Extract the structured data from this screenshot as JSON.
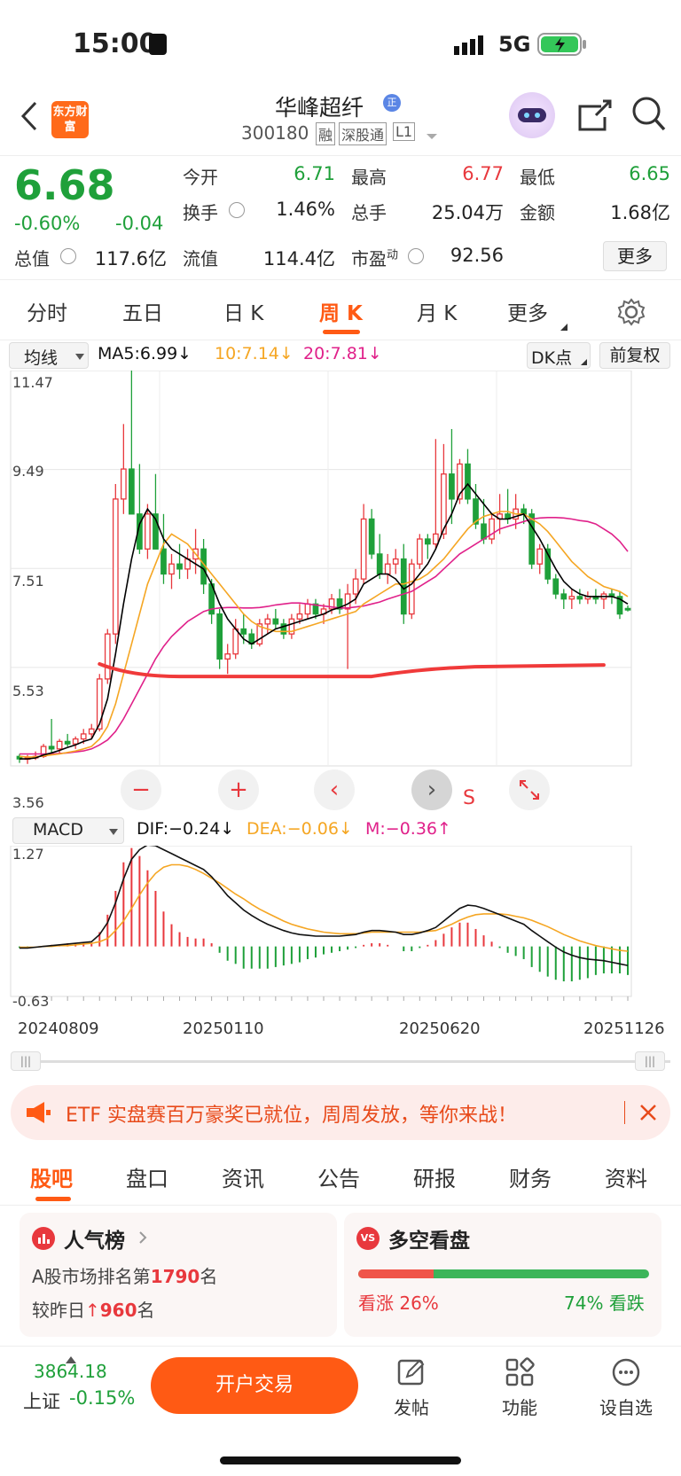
{
  "status_bar": {
    "time": "15:00",
    "network": "5G"
  },
  "header": {
    "logo": "东方财富",
    "stock_name": "华峰超纤",
    "stock_code": "300180",
    "tags": [
      "融",
      "深股通",
      "L1"
    ]
  },
  "quote": {
    "price": "6.68",
    "change_pct": "-0.60%",
    "change": "-0.04",
    "open_label": "今开",
    "open": "6.71",
    "high_label": "最高",
    "high": "6.77",
    "low_label": "最低",
    "low": "6.65",
    "turnover_label": "换手",
    "turnover": "1.46%",
    "volume_label": "总手",
    "volume": "25.04万",
    "amount_label": "金额",
    "amount": "1.68亿",
    "mktcap_label": "总值",
    "mktcap": "117.6亿",
    "float_label": "流值",
    "float": "114.4亿",
    "pe_label": "市盈",
    "pe_sup": "动",
    "pe": "92.56",
    "more_button": "更多"
  },
  "period_tabs": [
    "分时",
    "五日",
    "日 K",
    "周 K",
    "月 K",
    "更多"
  ],
  "active_period": "周 K",
  "ma_bar": {
    "selector": "均线",
    "ma5": "MA5:6.99↓",
    "ma10": "10:7.14↓",
    "ma20": "20:7.81↓",
    "dk_button": "DK点",
    "adjust_button": "前复权"
  },
  "chart_data": [
    {
      "type": "candlestick",
      "title": "",
      "y_ticks": [
        "11.47",
        "9.49",
        "7.51",
        "5.53",
        "3.56"
      ],
      "ylim": [
        3.56,
        11.47
      ],
      "series": [
        {
          "name": "MA5",
          "color": "#000000"
        },
        {
          "name": "10",
          "color": "#f5a623"
        },
        {
          "name": "20",
          "color": "#e0218a"
        }
      ],
      "candles_ohlc": [
        [
          3.75,
          3.8,
          3.62,
          3.7
        ],
        [
          3.7,
          3.78,
          3.6,
          3.72
        ],
        [
          3.72,
          3.85,
          3.68,
          3.75
        ],
        [
          3.75,
          4.0,
          3.72,
          3.95
        ],
        [
          3.95,
          4.5,
          3.8,
          3.9
        ],
        [
          3.9,
          4.1,
          3.8,
          4.05
        ],
        [
          4.05,
          4.2,
          3.95,
          4.0
        ],
        [
          4.0,
          4.15,
          3.9,
          4.1
        ],
        [
          4.1,
          4.3,
          4.0,
          4.2
        ],
        [
          4.2,
          4.4,
          4.1,
          4.3
        ],
        [
          4.3,
          5.4,
          4.25,
          5.3
        ],
        [
          5.3,
          6.3,
          5.2,
          6.2
        ],
        [
          6.2,
          9.2,
          6.0,
          8.9
        ],
        [
          8.9,
          10.4,
          8.6,
          9.5
        ],
        [
          9.5,
          11.47,
          8.8,
          8.6
        ],
        [
          8.6,
          9.6,
          7.8,
          7.9
        ],
        [
          7.9,
          8.8,
          7.7,
          8.6
        ],
        [
          8.6,
          9.4,
          7.9,
          7.9
        ],
        [
          7.9,
          8.6,
          7.2,
          7.4
        ],
        [
          7.4,
          7.8,
          7.1,
          7.6
        ],
        [
          7.6,
          8.0,
          7.3,
          7.5
        ],
        [
          7.5,
          7.9,
          7.3,
          7.7
        ],
        [
          7.7,
          8.3,
          7.4,
          7.9
        ],
        [
          7.9,
          8.1,
          7.0,
          7.2
        ],
        [
          7.2,
          7.3,
          6.4,
          6.6
        ],
        [
          6.6,
          6.7,
          5.5,
          5.7
        ],
        [
          5.7,
          6.0,
          5.4,
          5.8
        ],
        [
          5.8,
          6.5,
          5.7,
          6.3
        ],
        [
          6.3,
          6.6,
          6.0,
          6.2
        ],
        [
          6.2,
          6.3,
          5.9,
          6.0
        ],
        [
          6.0,
          6.5,
          5.95,
          6.4
        ],
        [
          6.4,
          6.6,
          6.2,
          6.5
        ],
        [
          6.5,
          6.7,
          6.3,
          6.4
        ],
        [
          6.4,
          6.5,
          6.1,
          6.2
        ],
        [
          6.2,
          6.6,
          6.1,
          6.5
        ],
        [
          6.5,
          6.8,
          6.4,
          6.6
        ],
        [
          6.6,
          6.9,
          6.5,
          6.8
        ],
        [
          6.8,
          6.9,
          6.5,
          6.6
        ],
        [
          6.6,
          6.8,
          6.4,
          6.7
        ],
        [
          6.7,
          7.0,
          6.6,
          6.9
        ],
        [
          6.9,
          7.1,
          6.6,
          6.7
        ],
        [
          6.7,
          7.2,
          5.5,
          7.0
        ],
        [
          7.0,
          7.5,
          6.8,
          7.3
        ],
        [
          7.3,
          8.8,
          7.2,
          8.5
        ],
        [
          8.5,
          8.7,
          7.7,
          7.8
        ],
        [
          7.8,
          8.2,
          7.3,
          7.4
        ],
        [
          7.4,
          7.8,
          7.2,
          7.6
        ],
        [
          7.6,
          7.9,
          7.4,
          7.7
        ],
        [
          7.7,
          8.0,
          6.4,
          6.6
        ],
        [
          6.6,
          7.7,
          6.5,
          7.6
        ],
        [
          7.6,
          8.2,
          7.5,
          8.1
        ],
        [
          8.1,
          8.2,
          7.7,
          8.0
        ],
        [
          8.0,
          10.1,
          7.9,
          8.2
        ],
        [
          8.2,
          10.0,
          8.1,
          9.4
        ],
        [
          9.4,
          10.3,
          8.4,
          8.9
        ],
        [
          8.9,
          9.7,
          8.8,
          9.6
        ],
        [
          9.6,
          9.9,
          8.8,
          8.9
        ],
        [
          8.9,
          9.2,
          8.3,
          8.4
        ],
        [
          8.4,
          8.9,
          8.0,
          8.1
        ],
        [
          8.1,
          8.6,
          8.0,
          8.5
        ],
        [
          8.5,
          9.0,
          8.2,
          8.6
        ],
        [
          8.6,
          9.1,
          8.4,
          8.5
        ],
        [
          8.5,
          9.0,
          8.3,
          8.7
        ],
        [
          8.7,
          8.8,
          8.4,
          8.6
        ],
        [
          8.6,
          8.7,
          7.5,
          7.6
        ],
        [
          7.6,
          8.0,
          7.4,
          7.9
        ],
        [
          7.9,
          8.0,
          7.2,
          7.3
        ],
        [
          7.3,
          7.4,
          6.9,
          7.0
        ],
        [
          7.0,
          7.1,
          6.7,
          6.9
        ],
        [
          6.9,
          7.1,
          6.7,
          6.95
        ],
        [
          6.95,
          7.1,
          6.8,
          6.9
        ],
        [
          6.9,
          7.05,
          6.8,
          6.95
        ],
        [
          6.95,
          7.1,
          6.8,
          6.9
        ],
        [
          6.9,
          7.05,
          6.7,
          7.0
        ],
        [
          7.0,
          7.1,
          6.8,
          6.95
        ],
        [
          6.95,
          7.05,
          6.5,
          6.6
        ],
        [
          6.71,
          6.77,
          6.65,
          6.68
        ]
      ],
      "ma5": [
        3.7,
        3.7,
        3.72,
        3.78,
        3.82,
        3.87,
        3.93,
        3.98,
        4.05,
        4.1,
        4.4,
        4.9,
        5.8,
        6.8,
        7.7,
        8.4,
        8.7,
        8.5,
        8.1,
        7.9,
        7.8,
        7.7,
        7.6,
        7.5,
        7.2,
        6.8,
        6.5,
        6.3,
        6.1,
        6.0,
        6.1,
        6.2,
        6.3,
        6.35,
        6.4,
        6.45,
        6.5,
        6.55,
        6.6,
        6.68,
        6.73,
        6.8,
        6.9,
        7.2,
        7.3,
        7.4,
        7.4,
        7.3,
        7.1,
        7.2,
        7.4,
        7.6,
        7.9,
        8.3,
        8.6,
        9.0,
        9.2,
        9.0,
        8.8,
        8.6,
        8.5,
        8.5,
        8.55,
        8.6,
        8.35,
        8.1,
        7.8,
        7.5,
        7.25,
        7.1,
        7.0,
        6.95,
        6.95,
        6.95,
        6.95,
        6.9,
        6.8
      ],
      "ma10": [
        3.75,
        3.74,
        3.74,
        3.76,
        3.78,
        3.8,
        3.83,
        3.86,
        3.9,
        3.95,
        4.1,
        4.35,
        4.8,
        5.4,
        6.0,
        6.6,
        7.2,
        7.6,
        8.0,
        8.2,
        8.1,
        8.0,
        7.8,
        7.6,
        7.4,
        7.2,
        7.0,
        6.8,
        6.6,
        6.45,
        6.35,
        6.3,
        6.25,
        6.25,
        6.25,
        6.3,
        6.35,
        6.4,
        6.45,
        6.5,
        6.55,
        6.6,
        6.65,
        6.8,
        6.9,
        7.0,
        7.1,
        7.2,
        7.2,
        7.25,
        7.3,
        7.4,
        7.55,
        7.7,
        7.9,
        8.1,
        8.3,
        8.45,
        8.55,
        8.6,
        8.65,
        8.65,
        8.6,
        8.6,
        8.5,
        8.4,
        8.25,
        8.05,
        7.85,
        7.65,
        7.5,
        7.35,
        7.25,
        7.15,
        7.1,
        7.05,
        6.95
      ],
      "ma20": [
        3.8,
        3.8,
        3.8,
        3.8,
        3.8,
        3.81,
        3.82,
        3.84,
        3.86,
        3.9,
        3.98,
        4.08,
        4.25,
        4.5,
        4.8,
        5.1,
        5.4,
        5.7,
        5.95,
        6.15,
        6.3,
        6.45,
        6.55,
        6.65,
        6.7,
        6.72,
        6.73,
        6.73,
        6.72,
        6.72,
        6.73,
        6.75,
        6.78,
        6.8,
        6.82,
        6.82,
        6.8,
        6.78,
        6.76,
        6.74,
        6.72,
        6.72,
        6.74,
        6.76,
        6.8,
        6.84,
        6.9,
        6.95,
        7.0,
        7.05,
        7.15,
        7.25,
        7.35,
        7.5,
        7.65,
        7.8,
        7.9,
        8.0,
        8.1,
        8.2,
        8.3,
        8.35,
        8.4,
        8.45,
        8.5,
        8.52,
        8.53,
        8.53,
        8.52,
        8.5,
        8.47,
        8.45,
        8.4,
        8.3,
        8.2,
        8.05,
        7.85
      ]
    },
    {
      "type": "bar",
      "title": "MACD",
      "y_ticks": [
        "1.27",
        "-0.63"
      ],
      "ylim": [
        -0.63,
        1.27
      ],
      "legend": {
        "dif": "DIF:−0.24↓",
        "dea": "DEA:−0.06↓",
        "m": "M:−0.36↑"
      },
      "dif": [
        -0.02,
        -0.02,
        -0.01,
        0,
        0.01,
        0.02,
        0.03,
        0.04,
        0.05,
        0.06,
        0.15,
        0.3,
        0.55,
        0.85,
        1.1,
        1.22,
        1.28,
        1.27,
        1.22,
        1.17,
        1.12,
        1.07,
        1.02,
        0.97,
        0.88,
        0.76,
        0.64,
        0.55,
        0.46,
        0.39,
        0.33,
        0.28,
        0.24,
        0.2,
        0.17,
        0.15,
        0.14,
        0.13,
        0.13,
        0.13,
        0.13,
        0.14,
        0.15,
        0.18,
        0.2,
        0.2,
        0.19,
        0.18,
        0.15,
        0.15,
        0.17,
        0.2,
        0.24,
        0.32,
        0.4,
        0.48,
        0.52,
        0.51,
        0.48,
        0.44,
        0.4,
        0.36,
        0.32,
        0.28,
        0.2,
        0.13,
        0.06,
        -0.01,
        -0.07,
        -0.11,
        -0.14,
        -0.16,
        -0.17,
        -0.18,
        -0.2,
        -0.22,
        -0.24
      ],
      "dea": [
        -0.01,
        -0.01,
        -0.01,
        0,
        0,
        0.01,
        0.01,
        0.02,
        0.03,
        0.04,
        0.06,
        0.1,
        0.2,
        0.32,
        0.48,
        0.65,
        0.8,
        0.92,
        1.0,
        1.03,
        1.03,
        1.01,
        0.97,
        0.92,
        0.86,
        0.8,
        0.73,
        0.66,
        0.6,
        0.53,
        0.47,
        0.42,
        0.37,
        0.32,
        0.28,
        0.25,
        0.22,
        0.2,
        0.18,
        0.17,
        0.16,
        0.16,
        0.16,
        0.17,
        0.18,
        0.18,
        0.18,
        0.18,
        0.18,
        0.18,
        0.18,
        0.19,
        0.2,
        0.24,
        0.28,
        0.33,
        0.37,
        0.4,
        0.41,
        0.41,
        0.41,
        0.4,
        0.38,
        0.36,
        0.33,
        0.29,
        0.25,
        0.2,
        0.15,
        0.11,
        0.07,
        0.04,
        0.01,
        -0.01,
        -0.03,
        -0.05,
        -0.06
      ],
      "macd": [
        -0.02,
        -0.02,
        0,
        0,
        0.02,
        0.02,
        0.04,
        0.04,
        0.04,
        0.04,
        0.18,
        0.4,
        0.7,
        1.06,
        1.24,
        1.14,
        0.96,
        0.7,
        0.44,
        0.28,
        0.18,
        0.12,
        0.1,
        0.1,
        0.04,
        -0.08,
        -0.18,
        -0.22,
        -0.28,
        -0.28,
        -0.28,
        -0.28,
        -0.26,
        -0.24,
        -0.22,
        -0.2,
        -0.16,
        -0.14,
        -0.1,
        -0.08,
        -0.06,
        -0.04,
        -0.02,
        0.02,
        0.04,
        0.04,
        0.02,
        0,
        -0.06,
        -0.06,
        -0.02,
        0.02,
        0.08,
        0.16,
        0.24,
        0.3,
        0.3,
        0.22,
        0.14,
        0.06,
        -0.02,
        -0.08,
        -0.12,
        -0.16,
        -0.26,
        -0.32,
        -0.38,
        -0.42,
        -0.44,
        -0.44,
        -0.42,
        -0.4,
        -0.36,
        -0.34,
        -0.34,
        -0.34,
        -0.36
      ]
    }
  ],
  "chart_x_labels": [
    "20240809",
    "20250110",
    "20250620",
    "20251126"
  ],
  "macd_selector": "MACD",
  "chart_marker": "S",
  "banner": {
    "text": "ETF 实盘赛百万豪奖已就位，周周发放，等你来战！"
  },
  "info_tabs": [
    "股吧",
    "盘口",
    "资讯",
    "公告",
    "研报",
    "财务",
    "资料"
  ],
  "active_info_tab": "股吧",
  "popularity": {
    "title": "人气榜",
    "rank_prefix": "A股市场排名第",
    "rank": "1790",
    "rank_suffix": "名",
    "change_prefix": "较昨日",
    "change": "960",
    "change_suffix": "名"
  },
  "sentiment": {
    "title": "多空看盘",
    "bull_label": "看涨",
    "bull_pct": "26%",
    "bear_pct": "74%",
    "bear_label": "看跌",
    "bull_fraction": 0.26
  },
  "bottom_bar": {
    "index_value": "3864.18",
    "index_name": "上证",
    "index_change": "-0.15%",
    "trade_button": "开户交易",
    "post_label": "发帖",
    "function_label": "功能",
    "watchlist_label": "设自选"
  },
  "colors": {
    "up": "#e8383d",
    "down": "#1fa03a",
    "accent": "#ff5a14"
  }
}
